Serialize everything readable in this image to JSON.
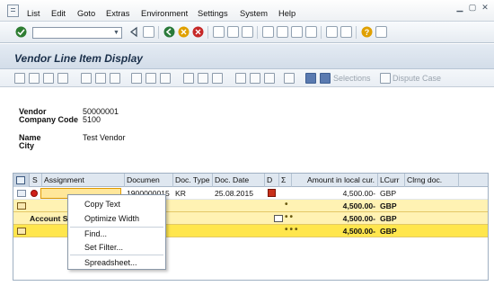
{
  "menubar": {
    "items": [
      "List",
      "Edit",
      "Goto",
      "Extras",
      "Environment",
      "Settings",
      "System",
      "Help"
    ]
  },
  "toolbar": {
    "command_field_value": ""
  },
  "title": "Vendor Line Item Display",
  "app_toolbar": {
    "selections_label": "Selections",
    "dispute_case_label": "Dispute Case"
  },
  "header": {
    "vendor_label": "Vendor",
    "vendor_value": "50000001",
    "company_code_label": "Company Code",
    "company_code_value": "5100",
    "name_label": "Name",
    "name_value": "Test Vendor",
    "city_label": "City",
    "city_value": ""
  },
  "grid": {
    "columns": [
      "S",
      "Assignment",
      "Documen",
      "Doc. Type",
      "Doc. Date",
      "D",
      "Σ",
      "Amount in local cur.",
      "LCurr",
      "Clrng doc."
    ],
    "rows": [
      {
        "assignment": "",
        "document": "1900000015",
        "doc_type": "KR",
        "doc_date": "25.08.2015",
        "amount": "4,500.00-",
        "lcurr": "GBP",
        "clrng_doc": ""
      },
      {
        "assignment": "",
        "document": "",
        "doc_type": "",
        "doc_date": "",
        "amount": "4,500.00-",
        "lcurr": "GBP",
        "clrng_doc": ""
      },
      {
        "assignment": "Account S",
        "document": "",
        "doc_type": "",
        "doc_date": "",
        "amount": "4,500.00-",
        "lcurr": "GBP",
        "clrng_doc": ""
      },
      {
        "assignment": "",
        "document": "",
        "doc_type": "",
        "doc_date": "",
        "amount": "4,500.00-",
        "lcurr": "GBP",
        "clrng_doc": ""
      }
    ]
  },
  "context_menu": {
    "items": [
      "Copy Text",
      "Optimize Width",
      "Find...",
      "Set Filter...",
      "Spreadsheet..."
    ]
  },
  "colors": {
    "subtotal_row": "#fff2b3",
    "total_row": "#ffe64d",
    "title_text": "#1a2f4a"
  }
}
